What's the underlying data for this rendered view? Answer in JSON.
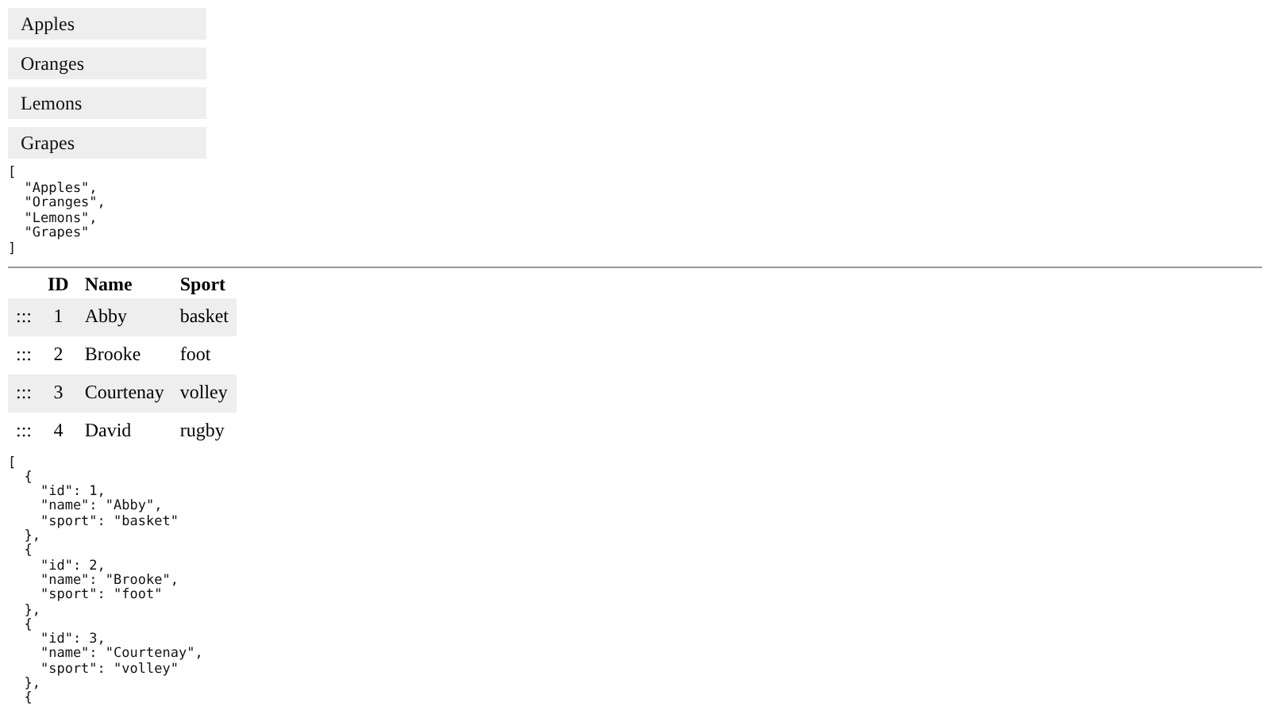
{
  "fruit_list": [
    "Apples",
    "Oranges",
    "Lemons",
    "Grapes"
  ],
  "fruit_json": "[\n  \"Apples\",\n  \"Oranges\",\n  \"Lemons\",\n  \"Grapes\"\n]",
  "table": {
    "columns": [
      "ID",
      "Name",
      "Sport"
    ],
    "rows": [
      {
        "handle": ":::",
        "id": "1",
        "name": "Abby",
        "sport": "basket"
      },
      {
        "handle": ":::",
        "id": "2",
        "name": "Brooke",
        "sport": "foot"
      },
      {
        "handle": ":::",
        "id": "3",
        "name": "Courtenay",
        "sport": "volley"
      },
      {
        "handle": ":::",
        "id": "4",
        "name": "David",
        "sport": "rugby"
      }
    ]
  },
  "table_json": "[\n  {\n    \"id\": 1,\n    \"name\": \"Abby\",\n    \"sport\": \"basket\"\n  },\n  {\n    \"id\": 2,\n    \"name\": \"Brooke\",\n    \"sport\": \"foot\"\n  },\n  {\n    \"id\": 3,\n    \"name\": \"Courtenay\",\n    \"sport\": \"volley\"\n  },\n  {"
}
